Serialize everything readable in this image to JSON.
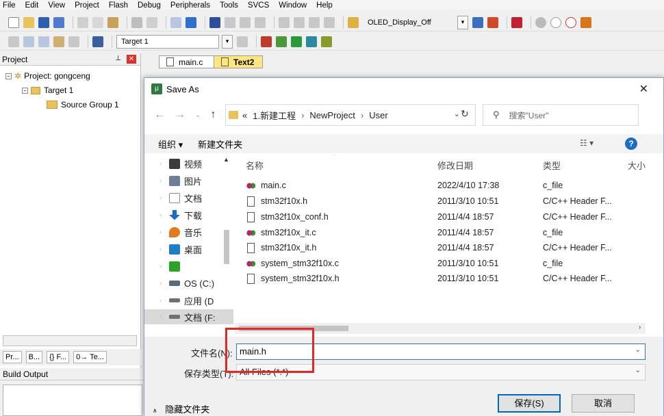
{
  "menu": [
    "File",
    "Edit",
    "View",
    "Project",
    "Flash",
    "Debug",
    "Peripherals",
    "Tools",
    "SVCS",
    "Window",
    "Help"
  ],
  "toolbar": {
    "target_combo": "OLED_Display_Off",
    "target_select": "Target 1"
  },
  "project_panel": {
    "title": "Project",
    "tree": [
      "Project: gongceng",
      "Target 1",
      "Source Group 1"
    ],
    "tabs": [
      "Pr...",
      "B...",
      "{} F...",
      "0→ Te..."
    ]
  },
  "editor_tabs": [
    "main.c",
    "Text2"
  ],
  "build_output": {
    "title": "Build Output"
  },
  "dialog": {
    "title": "Save As",
    "address": {
      "prefix": "«",
      "crumbs": [
        "1.新建工程",
        "NewProject",
        "User"
      ]
    },
    "search_placeholder": "搜索\"User\"",
    "organize_label": "组织 ▾",
    "new_folder_label": "新建文件夹",
    "nav_items": [
      {
        "label": "视频",
        "color": "#3b3b3b"
      },
      {
        "label": "图片",
        "color": "#6d7f96"
      },
      {
        "label": "文档",
        "color": "#8a8a8a"
      },
      {
        "label": "下载",
        "color": "#1f6cc1"
      },
      {
        "label": "音乐",
        "color": "#e37a1e"
      },
      {
        "label": "桌面",
        "color": "#1f7ec9"
      },
      {
        "label": "",
        "color": "#2aa52a"
      },
      {
        "label": "OS (C:)",
        "color": "#5a6b7a"
      },
      {
        "label": "应用 (D",
        "color": "#707070"
      },
      {
        "label": "文档 (F:",
        "color": "#707070"
      }
    ],
    "columns": [
      "名称",
      "修改日期",
      "类型",
      "大小"
    ],
    "files": [
      {
        "name": "main.c",
        "date": "2022/4/10 17:38",
        "type": "c_file",
        "icon": "c-file-icon"
      },
      {
        "name": "stm32f10x.h",
        "date": "2011/3/10 10:51",
        "type": "C/C++ Header F...",
        "icon": "h-file-icon"
      },
      {
        "name": "stm32f10x_conf.h",
        "date": "2011/4/4 18:57",
        "type": "C/C++ Header F...",
        "icon": "h-file-icon"
      },
      {
        "name": "stm32f10x_it.c",
        "date": "2011/4/4 18:57",
        "type": "c_file",
        "icon": "c-file-icon"
      },
      {
        "name": "stm32f10x_it.h",
        "date": "2011/4/4 18:57",
        "type": "C/C++ Header F...",
        "icon": "h-file-icon"
      },
      {
        "name": "system_stm32f10x.c",
        "date": "2011/3/10 10:51",
        "type": "c_file",
        "icon": "c-file-icon"
      },
      {
        "name": "system_stm32f10x.h",
        "date": "2011/3/10 10:51",
        "type": "C/C++ Header F...",
        "icon": "h-file-icon"
      }
    ],
    "filename_label": "文件名(N):",
    "filename_value": "main.h",
    "filetype_label": "保存类型(T):",
    "filetype_value": "All Files (*.*)",
    "hide_folders": "隐藏文件夹",
    "save_button": "保存(S)",
    "cancel_button": "取消"
  },
  "colors": {
    "highlight": "#e32626",
    "accent": "#0067c0"
  }
}
